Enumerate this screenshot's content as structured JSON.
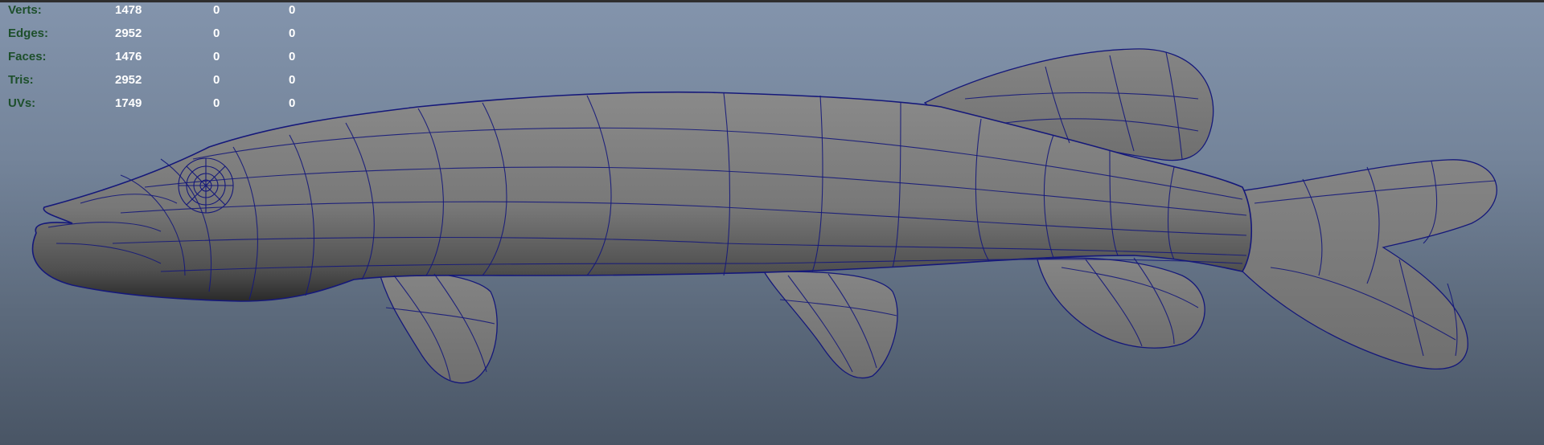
{
  "hud": {
    "rows": [
      {
        "label": "Verts:",
        "values": [
          "1478",
          "0",
          "0"
        ]
      },
      {
        "label": "Edges:",
        "values": [
          "2952",
          "0",
          "0"
        ]
      },
      {
        "label": "Faces:",
        "values": [
          "1476",
          "0",
          "0"
        ]
      },
      {
        "label": "Tris:",
        "values": [
          "2952",
          "0",
          "0"
        ]
      },
      {
        "label": "UVs:",
        "values": [
          "1749",
          "0",
          "0"
        ]
      }
    ]
  },
  "colors": {
    "label": "#1d4f2b",
    "value": "#ffffff",
    "wireframe": "#15187a",
    "surface": "#7c7c7c"
  },
  "icons": {
    "model": "pike-fish-wireframe-mesh"
  }
}
